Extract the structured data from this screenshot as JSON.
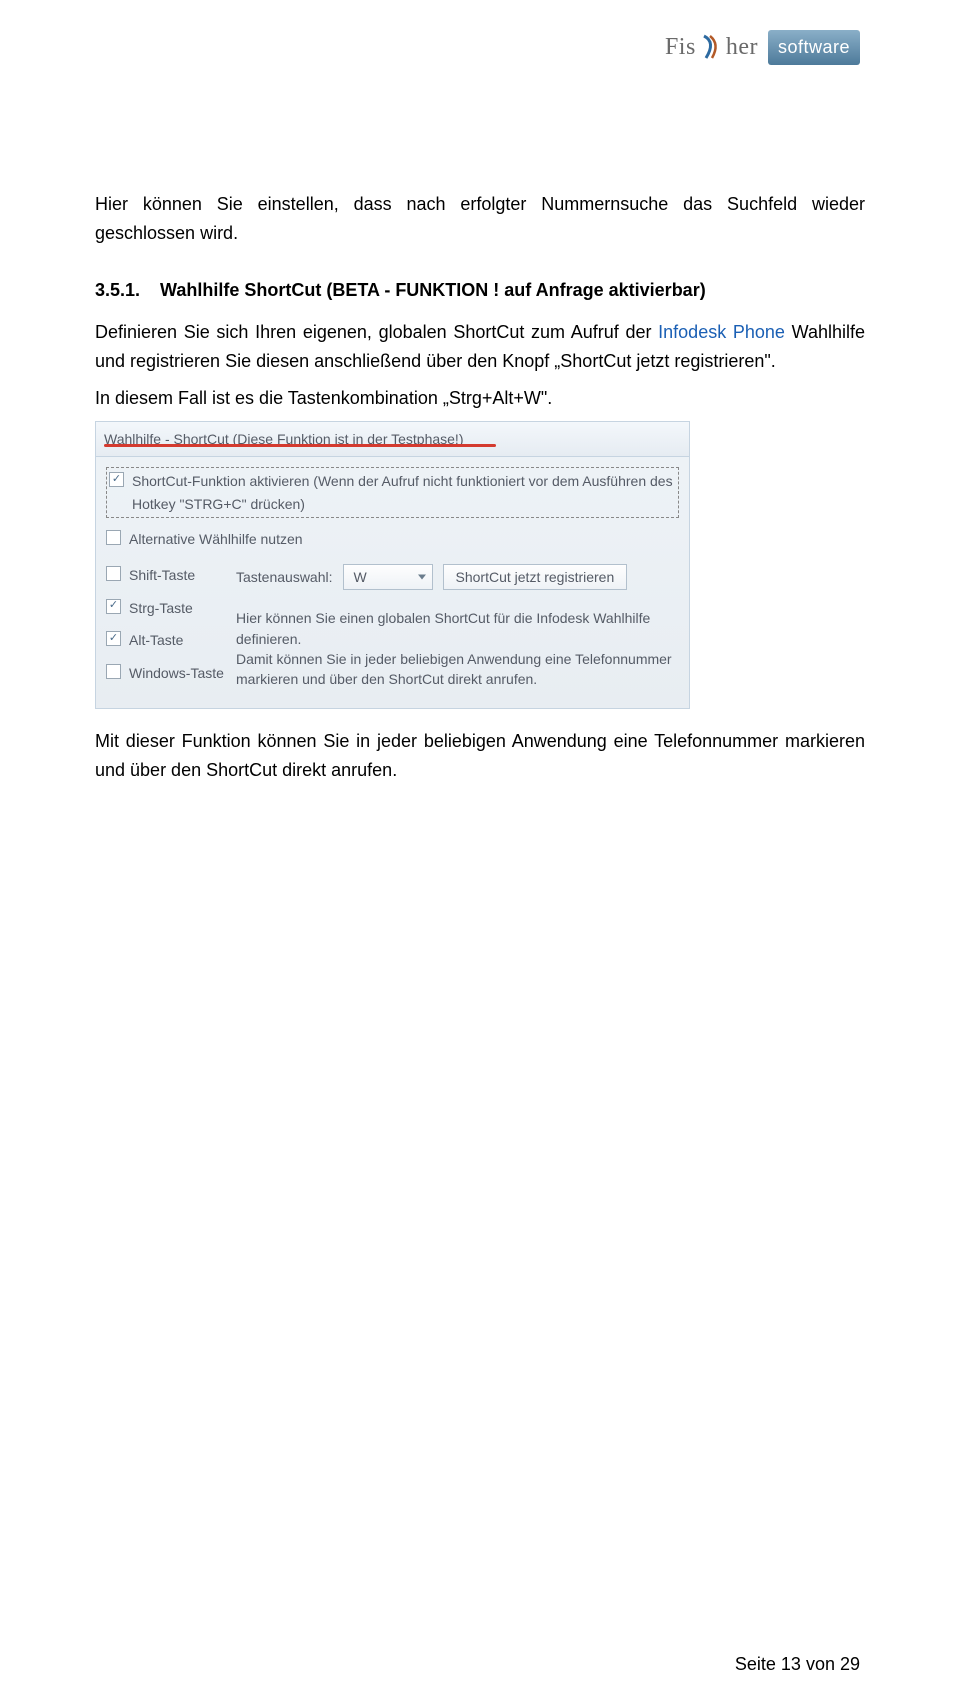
{
  "logo": {
    "part1": "Fis",
    "part2": "her",
    "software": "software"
  },
  "para1": "Hier können Sie einstellen, dass nach erfolgter Nummernsuche das Suchfeld wieder geschlossen wird.",
  "section": {
    "num": "3.5.1.",
    "title": "Wahlhilfe ShortCut (BETA - FUNKTION ! auf Anfrage aktivierbar)"
  },
  "para2a": "Definieren Sie sich Ihren eigenen, globalen ShortCut zum Aufruf der ",
  "para2link": "Infodesk Phone",
  "para2b": " Wahlhilfe und registrieren Sie diesen anschließend über den Knopf „ShortCut jetzt registrieren\".",
  "para3": "In diesem Fall ist es die Tastenkombination „Strg+Alt+W\".",
  "screenshot": {
    "title": "Wahlhilfe - ShortCut (Diese Funktion ist in der Testphase!)",
    "opt1": "ShortCut-Funktion aktivieren (Wenn der Aufruf nicht funktioniert vor dem Ausführen des Hotkey \"STRG+C\" drücken)",
    "opt2": "Alternative Wählhilfe nutzen",
    "kShift": "Shift-Taste",
    "kStrg": "Strg-Taste",
    "kAlt": "Alt-Taste",
    "kWin": "Windows-Taste",
    "pickerLabel": "Tastenauswahl:",
    "pickerValue": "W",
    "registerBtn": "ShortCut jetzt registrieren",
    "desc": "Hier können Sie einen globalen ShortCut für die Infodesk Wahlhilfe definieren.\nDamit können Sie in jeder beliebigen Anwendung eine Telefonnummer markieren und über den ShortCut direkt anrufen."
  },
  "para4": "Mit dieser Funktion können Sie in jeder beliebigen Anwendung eine Telefonnummer markieren und über den ShortCut direkt anrufen.",
  "footer": "Seite 13 von 29"
}
